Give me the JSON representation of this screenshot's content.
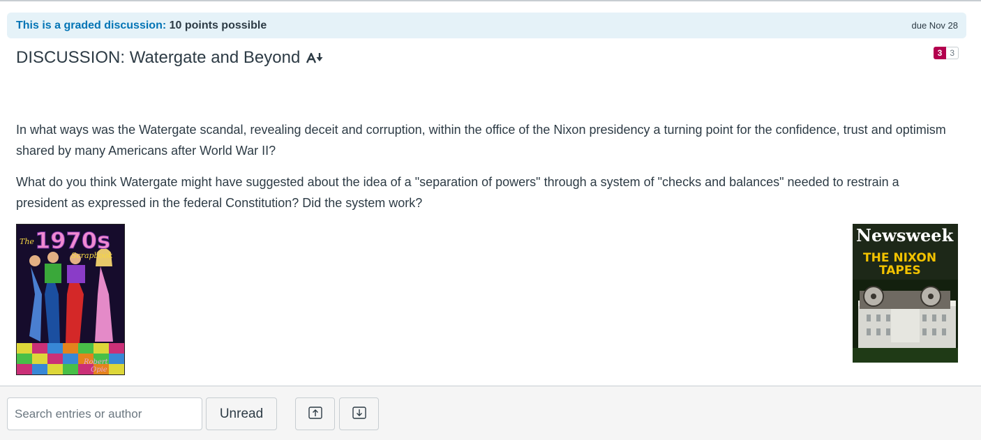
{
  "banner": {
    "prefix": "This is a graded discussion:",
    "points": "10 points possible",
    "due": "due Nov 28"
  },
  "discussion": {
    "title": "DISCUSSION: Watergate and Beyond",
    "unread_count": "3",
    "total_count": "3",
    "paragraphs": [
      "In what ways was the Watergate scandal, revealing deceit and corruption, within the office of the Nixon presidency a turning point for the confidence, trust and optimism shared by many Americans after World War II?",
      "What do you think Watergate might have suggested about the idea of a \"separation of powers\" through a system of \"checks and balances\" needed to restrain a president as expressed in the federal Constitution? Did the system work?"
    ]
  },
  "images": {
    "left": {
      "title_text": "The 1970s",
      "subtitle_text": "Scrapbook",
      "author_text": "Robert Opie"
    },
    "right": {
      "masthead": "Newsweek",
      "headline_line1": "THE NIXON",
      "headline_line2": "TAPES"
    }
  },
  "toolbar": {
    "search_placeholder": "Search entries or author",
    "unread_label": "Unread"
  },
  "icons": {
    "immersive_reader": "immersive-reader-icon",
    "expand": "expand-all-icon",
    "collapse": "collapse-all-icon"
  },
  "colors": {
    "link_blue": "#0374b5",
    "banner_bg": "#e5f2f8",
    "unread_badge": "#b3004e",
    "text": "#2d3b45"
  }
}
